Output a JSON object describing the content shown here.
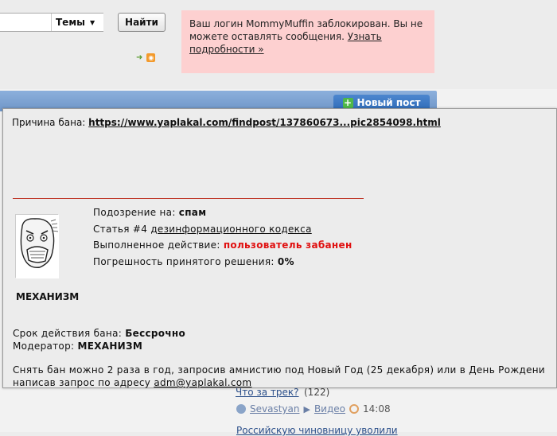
{
  "search": {
    "value": "",
    "topic_select": "Темы",
    "find_button": "Найти"
  },
  "ban_notice": {
    "text": "Ваш логин MommyMuffin заблокирован. Вы не можете оставлять сообщения. ",
    "link": "Узнать подробности »"
  },
  "toolbar": {
    "new_post": "Новый пост"
  },
  "popup": {
    "reason_label": "Причина бана: ",
    "reason_link": "https://www.yaplakal.com/findpost/137860673...pic2854098.html",
    "suspicion_label": "Подозрение на: ",
    "suspicion_value": "спам",
    "article_label": "Статья #4 ",
    "article_link": "дезинформационного кодекса",
    "action_label": "Выполненное действие: ",
    "action_value": "пользователь забанен",
    "error_label": "Погрешность принятого решения: ",
    "error_value": "0%",
    "moderator_name": "МЕХАНИЗМ",
    "term_label": "Срок действия бана: ",
    "term_value": "Бессрочно",
    "moderator_label": "Модератор: ",
    "moderator_value": "МЕХАНИЗМ",
    "amnesty_line1": "Снять бан можно 2 раза в год, запросив амнистию под Новый Год (25 декабря) или в День Рождени",
    "amnesty_line2_prefix": "написав запрос по адресу ",
    "amnesty_email": "adm@yaplakal.com"
  },
  "feed": {
    "track_title": "Что за трек?",
    "track_count": "(122)",
    "author": "Sevastyan",
    "section": "Видео",
    "time": "14:08",
    "next_title": "Российскую чиновницу уволили"
  }
}
